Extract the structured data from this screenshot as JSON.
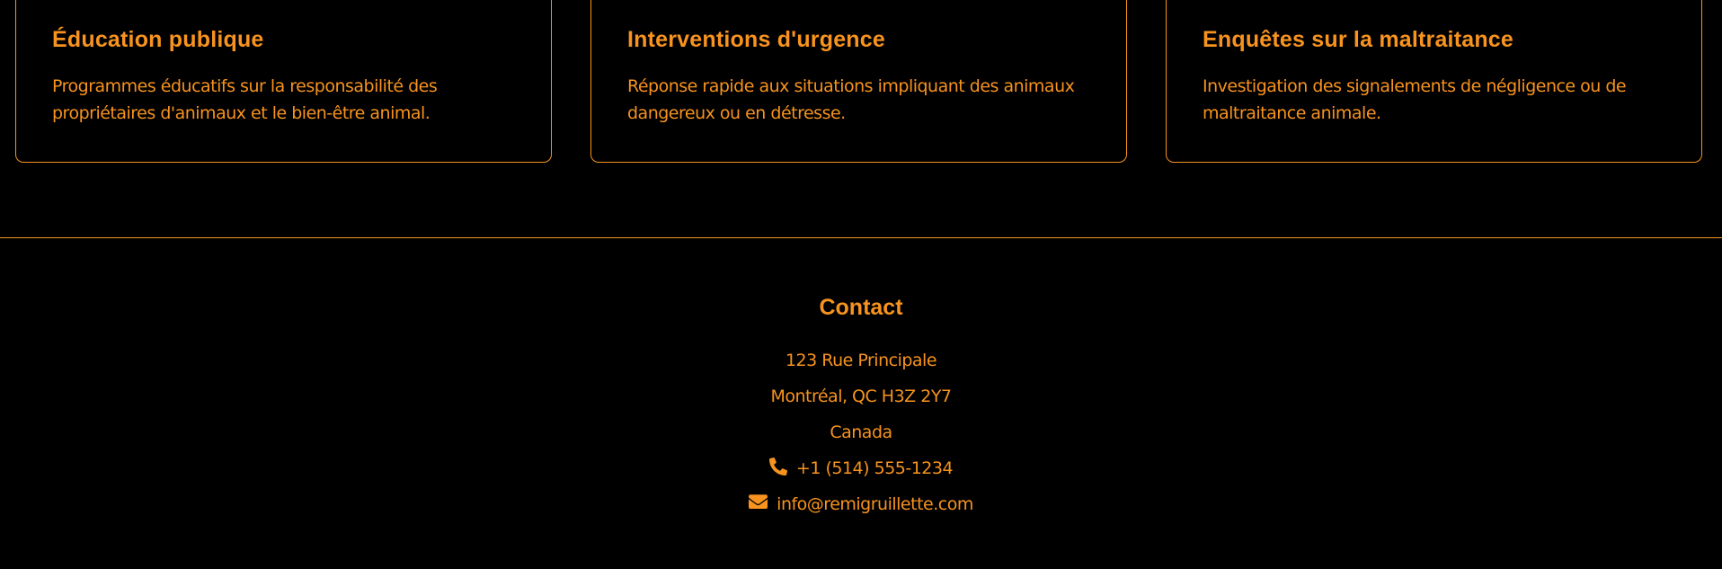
{
  "services": {
    "cards": [
      {
        "title": "Éducation publique",
        "text": "Programmes éducatifs sur la responsabilité des propriétaires d'animaux et le bien-être animal."
      },
      {
        "title": "Interventions d'urgence",
        "text": "Réponse rapide aux situations impliquant des animaux dangereux ou en détresse."
      },
      {
        "title": "Enquêtes sur la maltraitance",
        "text": "Investigation des signalements de négligence ou de maltraitance animale."
      }
    ]
  },
  "contact": {
    "title": "Contact",
    "address_line1": "123 Rue Principale",
    "address_line2": "Montréal, QC H3Z 2Y7",
    "country": "Canada",
    "phone": "+1 (514) 555-1234",
    "phone_icon": "phone-icon",
    "email": "info@remigruillette.com",
    "email_icon": "envelope-icon"
  },
  "colors": {
    "background": "#000000",
    "accent": "#f7931e"
  }
}
